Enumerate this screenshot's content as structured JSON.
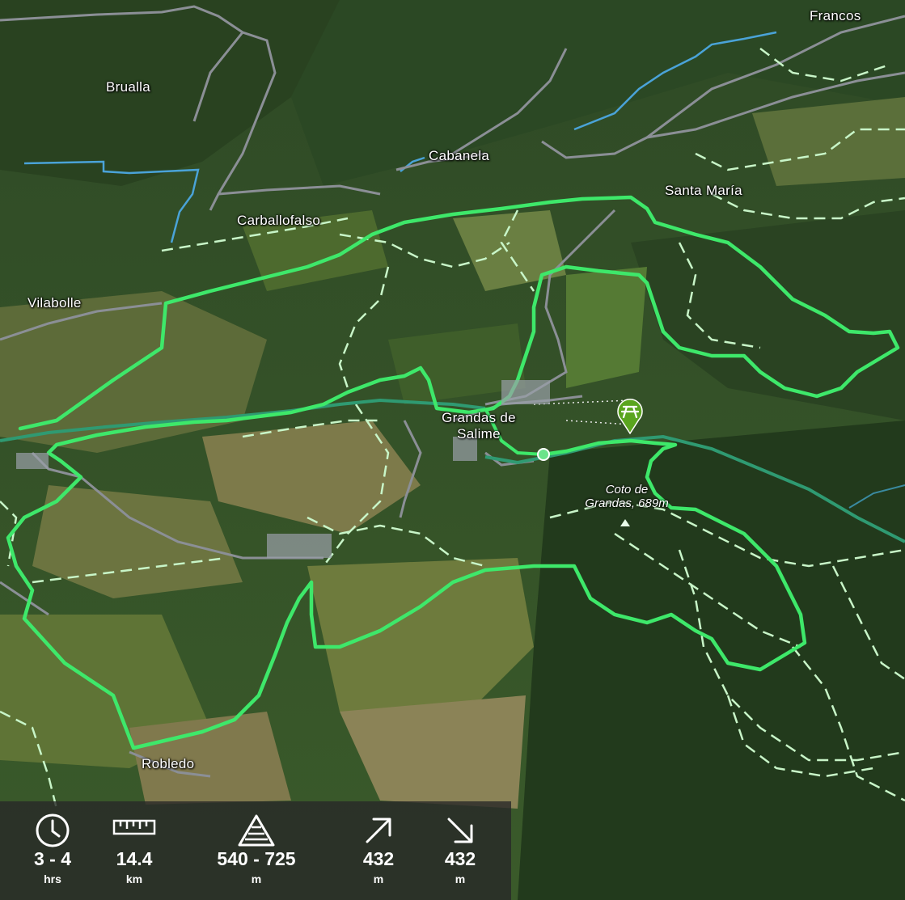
{
  "map": {
    "places": [
      {
        "id": "francos",
        "name": "Francos"
      },
      {
        "id": "brualla",
        "name": "Brualla"
      },
      {
        "id": "cabanela",
        "name": "Cabanela"
      },
      {
        "id": "santa-maria",
        "name": "Santa María"
      },
      {
        "id": "carballofalso",
        "name": "Carballofalso"
      },
      {
        "id": "vilabolle",
        "name": "Vilabolle"
      },
      {
        "id": "grandas",
        "name": "Grandas de Salime"
      },
      {
        "id": "robledo",
        "name": "Robledo"
      }
    ],
    "peak": {
      "name_line1": "Coto de",
      "name_line2": "Grandas, 689m"
    },
    "poi": {
      "icon": "picnic-table-icon",
      "color": "#5aa51e"
    },
    "route_color": "#3ee86a",
    "river_color": "#4aa3d8",
    "track_color": "#c8f5c8"
  },
  "stats": {
    "duration": {
      "icon": "clock-icon",
      "value": "3 - 4",
      "unit": "hrs"
    },
    "distance": {
      "icon": "ruler-icon",
      "value": "14.4",
      "unit": "km"
    },
    "elevation": {
      "icon": "elevation-range-icon",
      "value": "540 - 725",
      "unit": "m"
    },
    "ascent": {
      "icon": "ascent-arrow-icon",
      "value": "432",
      "unit": "m"
    },
    "descent": {
      "icon": "descent-arrow-icon",
      "value": "432",
      "unit": "m"
    }
  }
}
